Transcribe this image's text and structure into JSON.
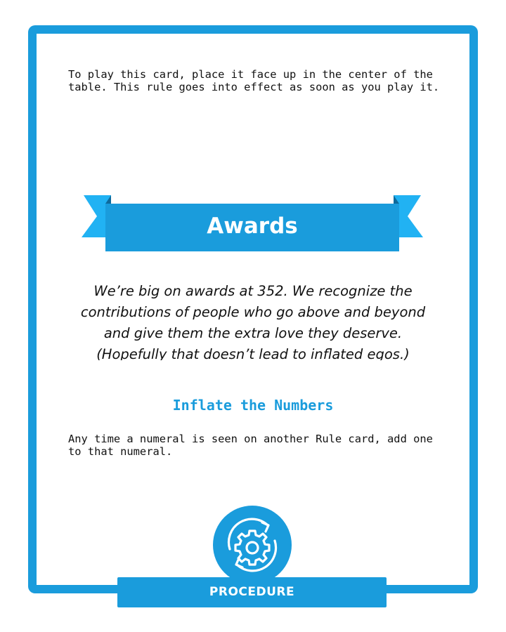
{
  "card": {
    "instructions": "To play this card, place it face up in the center of the table. This rule goes into effect as soon as you play it.",
    "title": "Awards",
    "flavor_text": "We’re big on awards at 352. We recognize the contributions of people who go above and beyond and give them the extra love they deserve. (Hopefully that doesn’t lead to inflated egos.)",
    "rule_title": "Inflate the Numbers",
    "rule_text": "Any time a numeral is seen on another Rule card, add one to that numeral.",
    "type_label": "PROCEDURE",
    "type_icon": "gear-cycle-icon"
  },
  "colors": {
    "accent": "#1a9cdc",
    "ribbon_tail": "#21b2f3",
    "ribbon_fold": "#0e6a9c",
    "text": "#111111",
    "background": "#ffffff"
  }
}
